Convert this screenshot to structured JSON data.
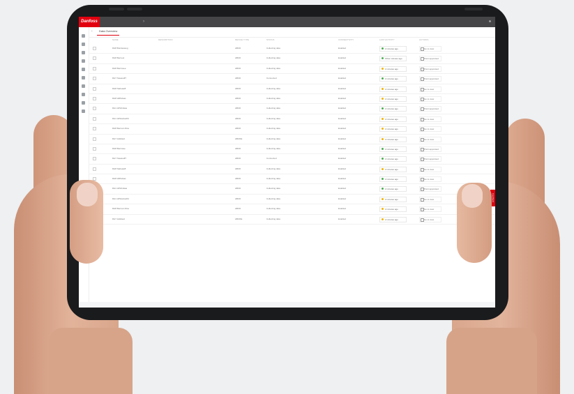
{
  "app": {
    "logo_text": "Danfoss",
    "active_tab": "Data Overview",
    "feedback_label": "Feedback"
  },
  "colors": {
    "brand": "#e2000f",
    "topbar": "#454547",
    "status_green": "#4caf50",
    "status_yellow": "#f4b400"
  },
  "columns": [
    "NAME",
    "DESCRIPTION",
    "DEVICE TYPE",
    "STATUS",
    "CONNECTIVITY",
    "LAST ACTIVITY",
    "ACTIONS"
  ],
  "rows": [
    {
      "name": "DH8 Bundesweg",
      "type": "ABCD",
      "status": "Collecting data",
      "conn": "Enabled",
      "last": "2 minutes ago",
      "last_color": "green",
      "action": "Go to view"
    },
    {
      "name": "DH8 Bernest",
      "type": "ABCD",
      "status": "Collecting data",
      "conn": "Enabled",
      "last": "Other minutes ago",
      "last_color": "green",
      "action": "Point appointed"
    },
    {
      "name": "DH8 Bernssee",
      "type": "ABCD",
      "status": "Collecting data",
      "conn": "Enabled",
      "last": "2 minutes ago",
      "last_color": "yellow",
      "action": "Point appointed"
    },
    {
      "name": "DH7 Sweasdf7",
      "type": "ABCD",
      "status": "Connected",
      "conn": "Enabled",
      "last": "2 minutes ago",
      "last_color": "green",
      "action": "Point appointed"
    },
    {
      "name": "DH8 Nabsaw8",
      "type": "ABCD",
      "status": "Collecting data",
      "conn": "Enabled",
      "last": "2 minutes ago",
      "last_color": "yellow",
      "action": "Go to view"
    },
    {
      "name": "DH8 HRSdsas",
      "type": "ABCD",
      "status": "Collecting data",
      "conn": "Enabled",
      "last": "2 minutes ago",
      "last_color": "yellow",
      "action": "Go to view"
    },
    {
      "name": "DH1 HPHhdsas",
      "type": "ABCD",
      "status": "Collecting data",
      "conn": "Enabled",
      "last": "2 minutes ago",
      "last_color": "green",
      "action": "Point appointed"
    },
    {
      "name": "DH1 HPHsdssdfd",
      "type": "ABCD",
      "status": "Collecting data",
      "conn": "Enabled",
      "last": "2 minutes ago",
      "last_color": "yellow",
      "action": "Go to view"
    },
    {
      "name": "DH8 Bernam Dice",
      "type": "ABCD",
      "status": "Collecting data",
      "conn": "Enabled",
      "last": "2 minutes ago",
      "last_color": "yellow",
      "action": "Go to view"
    },
    {
      "name": "DH7 Hdsfasd",
      "type": "ABCDE",
      "status": "Collecting data",
      "conn": "Enabled",
      "last": "2 minutes ago",
      "last_color": "yellow",
      "action": "Go to view"
    },
    {
      "name": "DH8 Bernstee",
      "type": "ABCD",
      "status": "Collecting data",
      "conn": "Enabled",
      "last": "2 minutes ago",
      "last_color": "green",
      "action": "Point appointed"
    },
    {
      "name": "DH7 Sweasdf7",
      "type": "ABCD",
      "status": "Connected",
      "conn": "Enabled",
      "last": "2 minutes ago",
      "last_color": "green",
      "action": "Point appointed"
    },
    {
      "name": "DH8 Nabsaw8",
      "type": "ABCD",
      "status": "Collecting data",
      "conn": "Enabled",
      "last": "2 minutes ago",
      "last_color": "yellow",
      "action": "Go to view"
    },
    {
      "name": "DH8 HRSdsas",
      "type": "ABCD",
      "status": "Collecting data",
      "conn": "Enabled",
      "last": "2 minutes ago",
      "last_color": "green",
      "action": "Go to view"
    },
    {
      "name": "DH1 HPHhdsas",
      "type": "ABCD",
      "status": "Collecting data",
      "conn": "Enabled",
      "last": "2 minutes ago",
      "last_color": "green",
      "action": "Point appointed"
    },
    {
      "name": "DH1 HPHsdssdfd",
      "type": "ABCD",
      "status": "Collecting data",
      "conn": "Enabled",
      "last": "2 minutes ago",
      "last_color": "yellow",
      "action": "Go to view"
    },
    {
      "name": "DH8 Bernam Dice",
      "type": "ABCD",
      "status": "Collecting data",
      "conn": "Enabled",
      "last": "2 minutes ago",
      "last_color": "yellow",
      "action": "Go to view"
    },
    {
      "name": "DH7 Hdsfasd",
      "type": "ABCDE",
      "status": "Collecting data",
      "conn": "Enabled",
      "last": "2 minutes ago",
      "last_color": "yellow",
      "action": "Go to view"
    }
  ],
  "sidebar_icons": [
    "home-icon",
    "dashboard-icon",
    "devices-icon",
    "alarm-icon",
    "list-icon",
    "settings-icon",
    "chart-icon",
    "info-icon",
    "user-icon",
    "help-icon"
  ]
}
